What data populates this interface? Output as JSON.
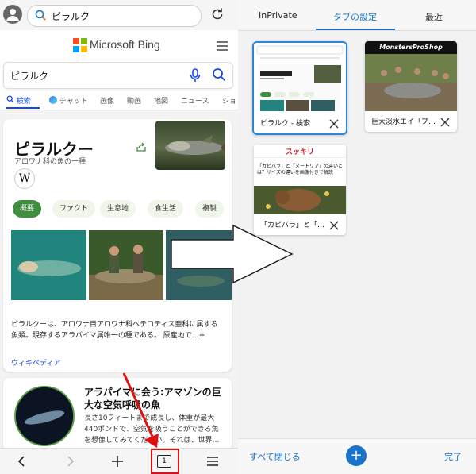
{
  "browser": {
    "address_text": "ピラルク",
    "bing_brand": "Microsoft Bing",
    "search_query": "ピラルク",
    "search_tabs": [
      "検索",
      "チャット",
      "画像",
      "動画",
      "地図",
      "ニュース",
      "ショ"
    ],
    "knowledge": {
      "title": "ピラルクー",
      "subtitle": "アロワナ科の魚の一種",
      "wiki_glyph": "W",
      "chips": [
        "概要",
        "ファクト",
        "生息地",
        "食生活",
        "複製"
      ],
      "description": "ピラルクーは、アロワナ目アロワナ科ヘテロティス亜科に属する魚類。現存するアラパイマ属唯一の種である。 原産地で…",
      "more": "+",
      "wiki_link": "ウィキペディア"
    },
    "result": {
      "heading": "アラパイマに会う:アマゾンの巨大な空気呼吸の魚",
      "snippet": "長さ10フィートまで成長し、体重が最大440ポンドで、空気を吸うことができる魚を想像してみてください。それは、世界…"
    },
    "tab_count": "1"
  },
  "switcher": {
    "tabs": [
      "InPrivate",
      "タブの設定",
      "最近"
    ],
    "cards": [
      {
        "caption": "ピラルク - 検索",
        "selected": true
      },
      {
        "caption": "巨大淡水エイ「ブ…",
        "selected": false,
        "banner": "MonstersProShop"
      },
      {
        "caption": "「カピバラ」と「…",
        "selected": false,
        "site": "スッキリ",
        "headline": "「カピバラ」と「ヌートリア」の違いとは？サイズの違いを画像付きで解説"
      }
    ],
    "close_all": "すべて閉じる",
    "add": "+",
    "done": "完了"
  },
  "colors": {
    "accent_blue": "#1a73c8",
    "bing_blue": "#174ae4",
    "chip_green": "#3f8e3f",
    "annotation_red": "#e01010"
  }
}
